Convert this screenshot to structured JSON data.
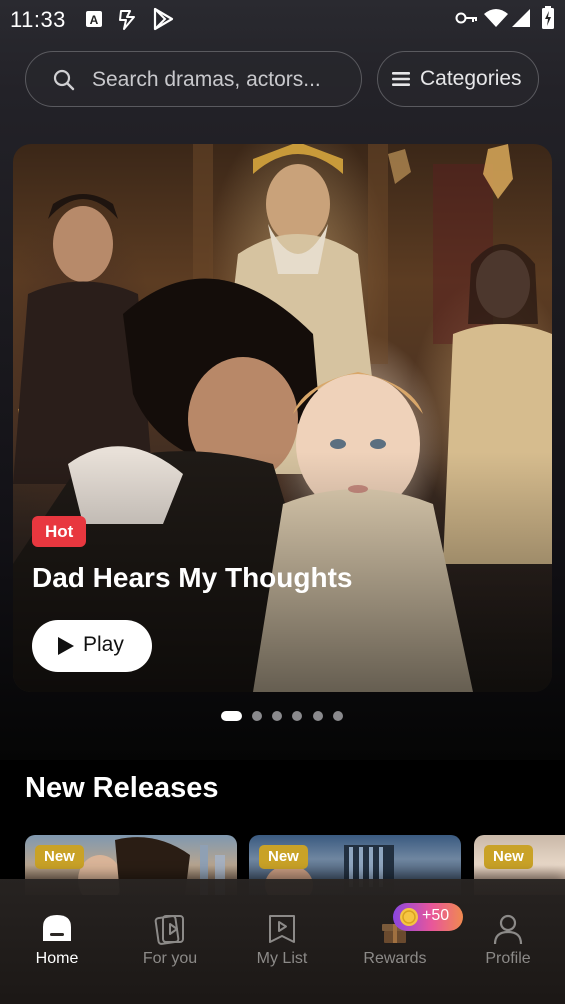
{
  "status_bar": {
    "time": "11:33",
    "left_icons": [
      "autofill-icon",
      "signal-bolt-icon",
      "play-store-icon"
    ],
    "right_icons": [
      "vpn-key-icon",
      "wifi-icon",
      "cell-signal-icon",
      "battery-icon"
    ]
  },
  "search": {
    "placeholder": "Search dramas, actors...",
    "icon": "search-icon"
  },
  "categories": {
    "label": "Categories",
    "icon": "menu-lines-icon"
  },
  "hero": {
    "badge": "Hot",
    "title": "Dad Hears My Thoughts",
    "play_label": "Play",
    "play_icon": "play-triangle-icon",
    "carousel_total": 6,
    "carousel_active_index": 0
  },
  "new_releases": {
    "title": "New Releases",
    "cards": [
      {
        "badge": "New"
      },
      {
        "badge": "New"
      },
      {
        "badge": "New"
      }
    ]
  },
  "bottom_nav": {
    "items": [
      {
        "label": "Home",
        "icon": "home-icon",
        "active": true
      },
      {
        "label": "For you",
        "icon": "video-cards-icon",
        "active": false
      },
      {
        "label": "My List",
        "icon": "bookmark-play-icon",
        "active": false
      },
      {
        "label": "Rewards",
        "icon": "gift-icon",
        "active": false
      },
      {
        "label": "Profile",
        "icon": "user-icon",
        "active": false
      }
    ],
    "rewards_badge": "+50"
  },
  "colors": {
    "hot_badge": "#e8373f",
    "new_badge": "#c9a227",
    "rewards_gradient_start": "#8a46e0",
    "rewards_gradient_end": "#f08a50"
  }
}
